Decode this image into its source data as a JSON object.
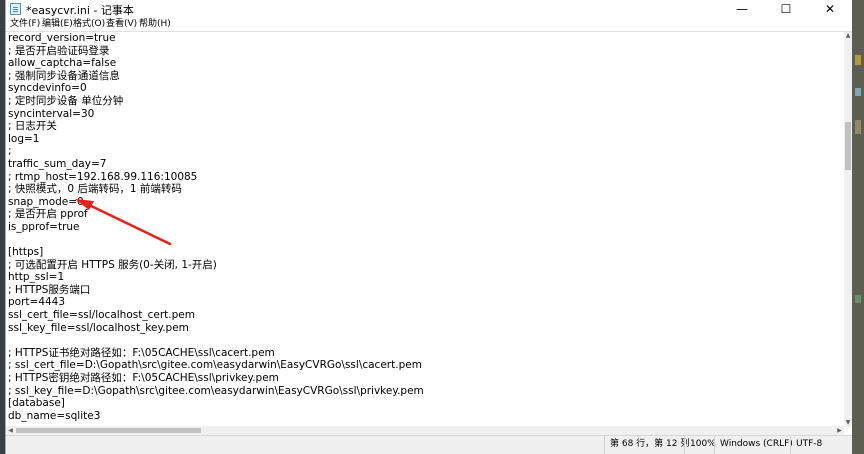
{
  "window": {
    "title": "*easycvr.ini - 记事本",
    "minimize_glyph": "—",
    "maximize_glyph": "☐",
    "close_glyph": "✕"
  },
  "menu": {
    "items": [
      {
        "label": "文件(F)"
      },
      {
        "label": "编辑(E)"
      },
      {
        "label": "格式(O)"
      },
      {
        "label": "查看(V)"
      },
      {
        "label": "帮助(H)"
      }
    ]
  },
  "editor": {
    "lines": [
      "record_version=true",
      "; 是否开启验证码登录",
      "allow_captcha=false",
      "; 强制同步设备通道信息",
      "syncdevinfo=0",
      "; 定时同步设备 单位分钟",
      "syncinterval=30",
      "; 日志开关",
      "log=1",
      ";",
      "traffic_sum_day=7",
      "; rtmp_host=192.168.99.116:10085",
      "; 快照模式，0 后端转码，1 前端转码",
      "snap_mode=0",
      "; 是否开启 pprof",
      "is_pprof=true",
      "",
      "[https]",
      "; 可选配置开启 HTTPS 服务(0-关闭, 1-开启)",
      "http_ssl=1",
      "; HTTPS服务端口",
      "port=4443",
      "ssl_cert_file=ssl/localhost_cert.pem",
      "ssl_key_file=ssl/localhost_key.pem",
      "",
      "; HTTPS证书绝对路径如：F:\\05CACHE\\ssl\\cacert.pem",
      "; ssl_cert_file=D:\\Gopath\\src\\gitee.com\\easydarwin\\EasyCVRGo\\ssl\\cacert.pem",
      "; HTTPS密钥绝对路径如：F:\\05CACHE\\ssl\\privkey.pem",
      "; ssl_key_file=D:\\Gopath\\src\\gitee.com\\easydarwin\\EasyCVRGo\\ssl\\privkey.pem",
      "[database]",
      "db_name=sqlite3"
    ]
  },
  "status": {
    "position": "第 68 行，第 12 列",
    "zoom": "100%",
    "line_ending": "Windows (CRLF)",
    "encoding": "UTF-8"
  },
  "annotation": {
    "arrow_color": "#e8201a"
  },
  "icons": {
    "app": "notepad-icon",
    "scroll_up": "scroll-up-icon",
    "scroll_down": "scroll-down-icon",
    "scroll_left": "scroll-left-icon",
    "scroll_right": "scroll-right-icon"
  }
}
